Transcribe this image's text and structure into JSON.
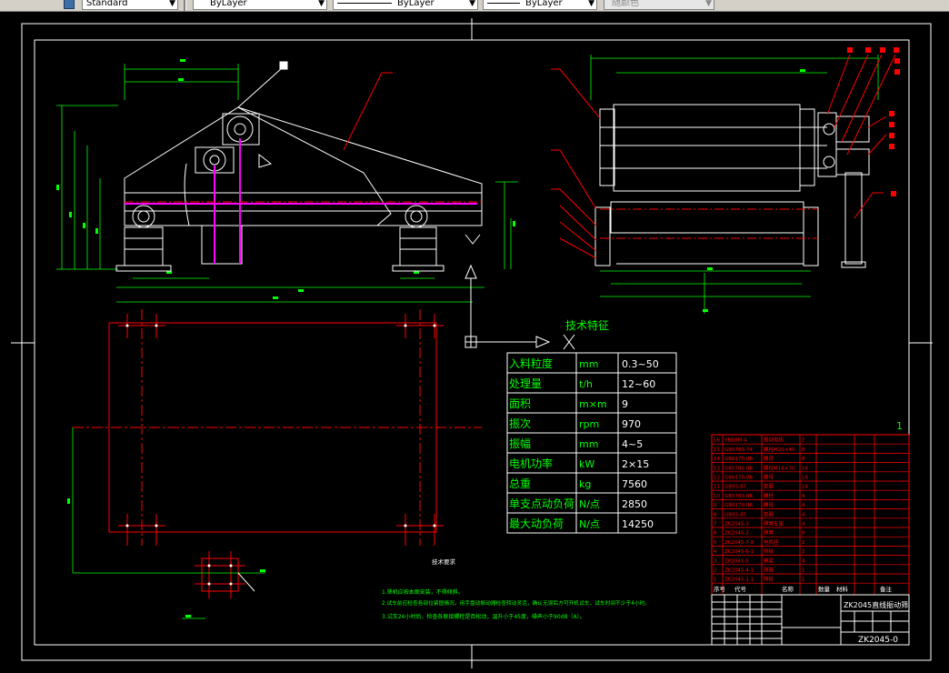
{
  "toolbar": {
    "text_style": "Standard",
    "layer_color": "ByLayer",
    "linetype": "ByLayer",
    "lineweight": "ByLayer",
    "plot_style": "随颜色"
  },
  "tech_table": {
    "title": "技术特征",
    "rows": [
      {
        "name": "入料粒度",
        "unit": "mm",
        "value": "0.3~50"
      },
      {
        "name": "处理量",
        "unit": "t/h",
        "value": "12~60"
      },
      {
        "name": "面积",
        "unit": "m×m",
        "value": "9"
      },
      {
        "name": "振次",
        "unit": "rpm",
        "value": "970"
      },
      {
        "name": "振幅",
        "unit": "mm",
        "value": "4~5"
      },
      {
        "name": "电机功率",
        "unit": "kW",
        "value": "2×15"
      },
      {
        "name": "总重",
        "unit": "kg",
        "value": "7560"
      },
      {
        "name": "单支点动负荷",
        "unit": "N/点",
        "value": "2850"
      },
      {
        "name": "最大动负荷",
        "unit": "N/点",
        "value": "14250"
      }
    ]
  },
  "notes": {
    "heading": "技术要求",
    "lines": [
      "1.筛机应按本图安装，不得倾斜。",
      "2.试车前应检查各部位紧固情况，用手盘动振动器检查转动灵活，确认无误后方可开机试车，试车时间不少于4小时。",
      "3.试车24小时后，检查各联接螺栓是否松动，温升小于45度，噪声小于90dB（A）。"
    ]
  },
  "title_block": {
    "drawing_name": "ZK2045直线振动筛",
    "drawing_no": "ZK2045-0",
    "sheet_mark": "1",
    "col_seq": "序号",
    "col_code": "代号",
    "col_name": "名称",
    "col_qty": "数量",
    "col_material": "材料",
    "col_note": "备注"
  },
  "bom_rows": [
    [
      "16",
      "YBB8M-4",
      "振动电机",
      "2",
      "",
      "",
      ""
    ],
    [
      "15",
      "GB5783-74",
      "螺栓M20×45",
      "8",
      "",
      "",
      ""
    ],
    [
      "14",
      "GB6170-86",
      "螺母",
      "8",
      "",
      "",
      ""
    ],
    [
      "13",
      "GB5782-86",
      "螺栓M16×70",
      "16",
      "",
      "",
      ""
    ],
    [
      "12",
      "GB6170-86",
      "螺母",
      "16",
      "",
      "",
      ""
    ],
    [
      "11",
      "GB93-87",
      "垫圈",
      "16",
      "",
      "",
      ""
    ],
    [
      "10",
      "GB5783-86",
      "螺栓",
      "4",
      "",
      "",
      ""
    ],
    [
      "9",
      "GB6170-86",
      "螺母",
      "4",
      "",
      "",
      ""
    ],
    [
      "8",
      "GB93-87",
      "垫圈",
      "4",
      "",
      "",
      ""
    ],
    [
      "7",
      "ZK2045-3",
      "弹簧支座",
      "4",
      "",
      "",
      ""
    ],
    [
      "6",
      "ZK2045-2",
      "弹簧",
      "8",
      "",
      "",
      ""
    ],
    [
      "5",
      "ZK2045-7-8",
      "电机座",
      "2",
      "",
      "",
      ""
    ],
    [
      "4",
      "ZK2045-6-1",
      "侧板",
      "2",
      "",
      "",
      ""
    ],
    [
      "3",
      "ZK2045-5",
      "横梁",
      "4",
      "",
      "",
      ""
    ],
    [
      "2",
      "ZK2045-4-1",
      "筛箱",
      "1",
      "",
      "",
      ""
    ],
    [
      "1",
      "ZK2045-1-1",
      "筛板",
      "1",
      "",
      "",
      ""
    ]
  ]
}
